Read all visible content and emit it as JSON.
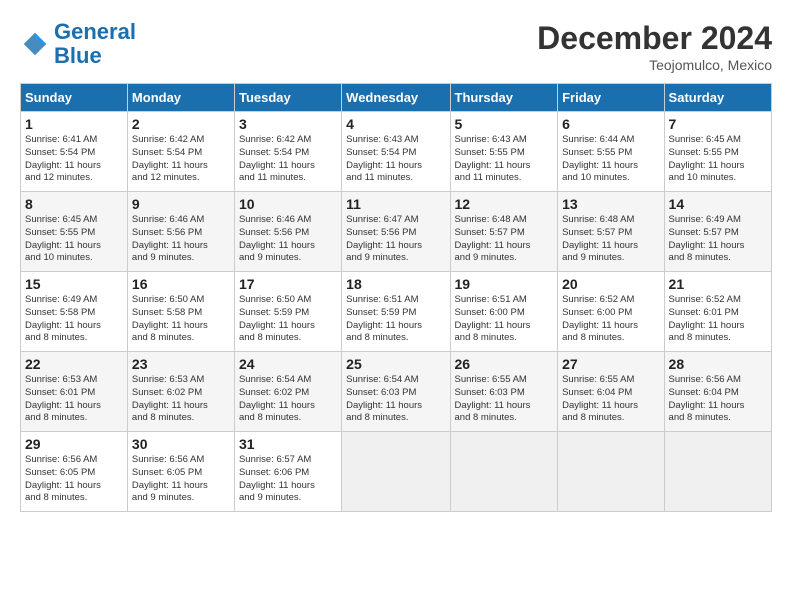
{
  "header": {
    "logo_line1": "General",
    "logo_line2": "Blue",
    "month_title": "December 2024",
    "location": "Teojomulco, Mexico"
  },
  "weekdays": [
    "Sunday",
    "Monday",
    "Tuesday",
    "Wednesday",
    "Thursday",
    "Friday",
    "Saturday"
  ],
  "weeks": [
    [
      {
        "day": "1",
        "info": "Sunrise: 6:41 AM\nSunset: 5:54 PM\nDaylight: 11 hours\nand 12 minutes."
      },
      {
        "day": "2",
        "info": "Sunrise: 6:42 AM\nSunset: 5:54 PM\nDaylight: 11 hours\nand 12 minutes."
      },
      {
        "day": "3",
        "info": "Sunrise: 6:42 AM\nSunset: 5:54 PM\nDaylight: 11 hours\nand 11 minutes."
      },
      {
        "day": "4",
        "info": "Sunrise: 6:43 AM\nSunset: 5:54 PM\nDaylight: 11 hours\nand 11 minutes."
      },
      {
        "day": "5",
        "info": "Sunrise: 6:43 AM\nSunset: 5:55 PM\nDaylight: 11 hours\nand 11 minutes."
      },
      {
        "day": "6",
        "info": "Sunrise: 6:44 AM\nSunset: 5:55 PM\nDaylight: 11 hours\nand 10 minutes."
      },
      {
        "day": "7",
        "info": "Sunrise: 6:45 AM\nSunset: 5:55 PM\nDaylight: 11 hours\nand 10 minutes."
      }
    ],
    [
      {
        "day": "8",
        "info": "Sunrise: 6:45 AM\nSunset: 5:55 PM\nDaylight: 11 hours\nand 10 minutes."
      },
      {
        "day": "9",
        "info": "Sunrise: 6:46 AM\nSunset: 5:56 PM\nDaylight: 11 hours\nand 9 minutes."
      },
      {
        "day": "10",
        "info": "Sunrise: 6:46 AM\nSunset: 5:56 PM\nDaylight: 11 hours\nand 9 minutes."
      },
      {
        "day": "11",
        "info": "Sunrise: 6:47 AM\nSunset: 5:56 PM\nDaylight: 11 hours\nand 9 minutes."
      },
      {
        "day": "12",
        "info": "Sunrise: 6:48 AM\nSunset: 5:57 PM\nDaylight: 11 hours\nand 9 minutes."
      },
      {
        "day": "13",
        "info": "Sunrise: 6:48 AM\nSunset: 5:57 PM\nDaylight: 11 hours\nand 9 minutes."
      },
      {
        "day": "14",
        "info": "Sunrise: 6:49 AM\nSunset: 5:57 PM\nDaylight: 11 hours\nand 8 minutes."
      }
    ],
    [
      {
        "day": "15",
        "info": "Sunrise: 6:49 AM\nSunset: 5:58 PM\nDaylight: 11 hours\nand 8 minutes."
      },
      {
        "day": "16",
        "info": "Sunrise: 6:50 AM\nSunset: 5:58 PM\nDaylight: 11 hours\nand 8 minutes."
      },
      {
        "day": "17",
        "info": "Sunrise: 6:50 AM\nSunset: 5:59 PM\nDaylight: 11 hours\nand 8 minutes."
      },
      {
        "day": "18",
        "info": "Sunrise: 6:51 AM\nSunset: 5:59 PM\nDaylight: 11 hours\nand 8 minutes."
      },
      {
        "day": "19",
        "info": "Sunrise: 6:51 AM\nSunset: 6:00 PM\nDaylight: 11 hours\nand 8 minutes."
      },
      {
        "day": "20",
        "info": "Sunrise: 6:52 AM\nSunset: 6:00 PM\nDaylight: 11 hours\nand 8 minutes."
      },
      {
        "day": "21",
        "info": "Sunrise: 6:52 AM\nSunset: 6:01 PM\nDaylight: 11 hours\nand 8 minutes."
      }
    ],
    [
      {
        "day": "22",
        "info": "Sunrise: 6:53 AM\nSunset: 6:01 PM\nDaylight: 11 hours\nand 8 minutes."
      },
      {
        "day": "23",
        "info": "Sunrise: 6:53 AM\nSunset: 6:02 PM\nDaylight: 11 hours\nand 8 minutes."
      },
      {
        "day": "24",
        "info": "Sunrise: 6:54 AM\nSunset: 6:02 PM\nDaylight: 11 hours\nand 8 minutes."
      },
      {
        "day": "25",
        "info": "Sunrise: 6:54 AM\nSunset: 6:03 PM\nDaylight: 11 hours\nand 8 minutes."
      },
      {
        "day": "26",
        "info": "Sunrise: 6:55 AM\nSunset: 6:03 PM\nDaylight: 11 hours\nand 8 minutes."
      },
      {
        "day": "27",
        "info": "Sunrise: 6:55 AM\nSunset: 6:04 PM\nDaylight: 11 hours\nand 8 minutes."
      },
      {
        "day": "28",
        "info": "Sunrise: 6:56 AM\nSunset: 6:04 PM\nDaylight: 11 hours\nand 8 minutes."
      }
    ],
    [
      {
        "day": "29",
        "info": "Sunrise: 6:56 AM\nSunset: 6:05 PM\nDaylight: 11 hours\nand 8 minutes."
      },
      {
        "day": "30",
        "info": "Sunrise: 6:56 AM\nSunset: 6:05 PM\nDaylight: 11 hours\nand 9 minutes."
      },
      {
        "day": "31",
        "info": "Sunrise: 6:57 AM\nSunset: 6:06 PM\nDaylight: 11 hours\nand 9 minutes."
      },
      {
        "day": "",
        "info": ""
      },
      {
        "day": "",
        "info": ""
      },
      {
        "day": "",
        "info": ""
      },
      {
        "day": "",
        "info": ""
      }
    ]
  ]
}
